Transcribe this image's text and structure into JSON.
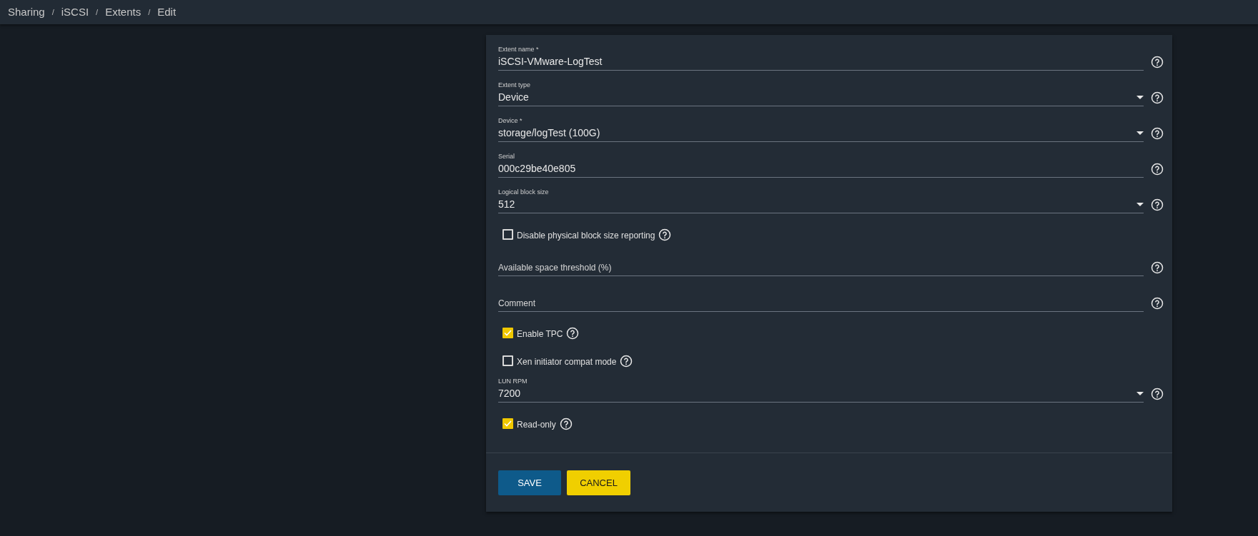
{
  "breadcrumb": [
    "Sharing",
    "iSCSI",
    "Extents",
    "Edit"
  ],
  "breadcrumb_separator": "/",
  "fields": [
    {
      "kind": "input",
      "label": "Extent name *",
      "value": "iSCSI-VMware-LogTest"
    },
    {
      "kind": "select",
      "label": "Extent type",
      "value": "Device"
    },
    {
      "kind": "select",
      "label": "Device *",
      "value": "storage/logTest (100G)"
    },
    {
      "kind": "input",
      "label": "Serial",
      "value": "000c29be40e805"
    },
    {
      "kind": "select",
      "label": "Logical block size",
      "value": "512"
    },
    {
      "kind": "checkbox",
      "label": "Disable physical block size reporting",
      "checked": false
    },
    {
      "kind": "empty",
      "placeholder": "Available space threshold (%)"
    },
    {
      "kind": "empty",
      "placeholder": "Comment"
    },
    {
      "kind": "checkbox",
      "label": "Enable TPC",
      "checked": true
    },
    {
      "kind": "checkbox",
      "label": "Xen initiator compat mode",
      "checked": false
    },
    {
      "kind": "select",
      "label": "LUN RPM",
      "value": "7200"
    },
    {
      "kind": "checkbox",
      "label": "Read-only",
      "checked": true
    }
  ],
  "buttons": [
    {
      "kind": "primary",
      "label": "SAVE"
    },
    {
      "kind": "secondary",
      "label": "CANCEL"
    }
  ]
}
